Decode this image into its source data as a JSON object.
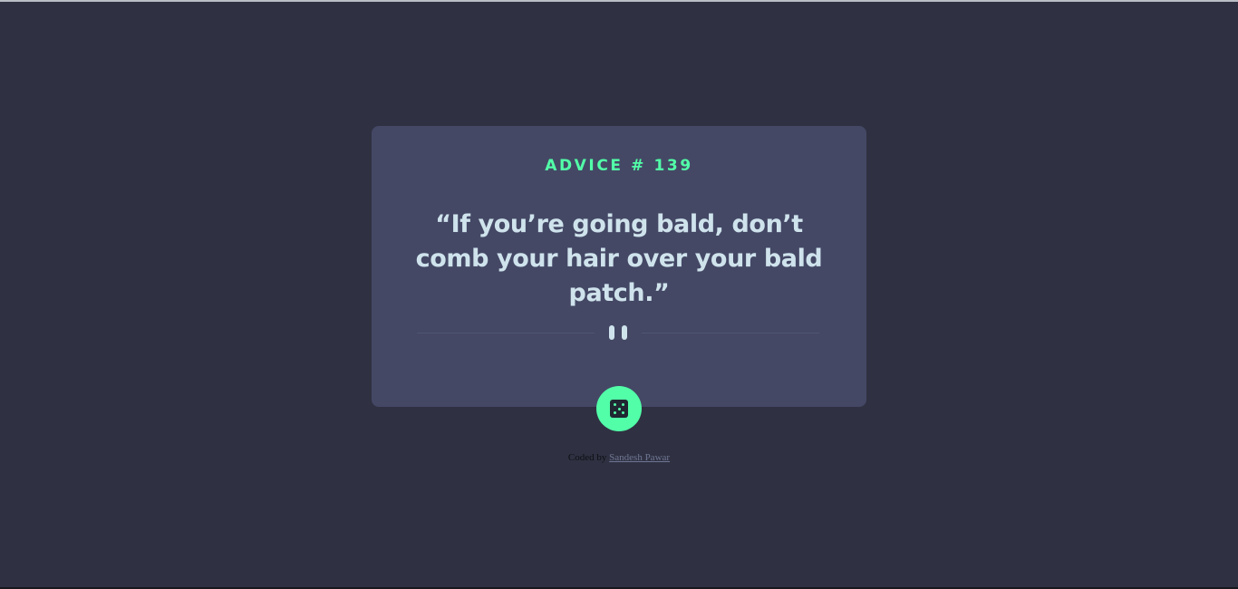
{
  "card": {
    "advice_label": "ADVICE # 139",
    "quote": "“If you’re going bald, don’t comb your hair over your bald patch.”"
  },
  "divider": {
    "icon": "pause-icon"
  },
  "dice_button": {
    "icon": "dice-icon"
  },
  "footer": {
    "prefix": "Coded by",
    "author": "Sandesh Pawar"
  },
  "colors": {
    "background": "#2f3142",
    "card": "#444865",
    "accent": "#52ffa8",
    "text": "#cfe3ec"
  }
}
